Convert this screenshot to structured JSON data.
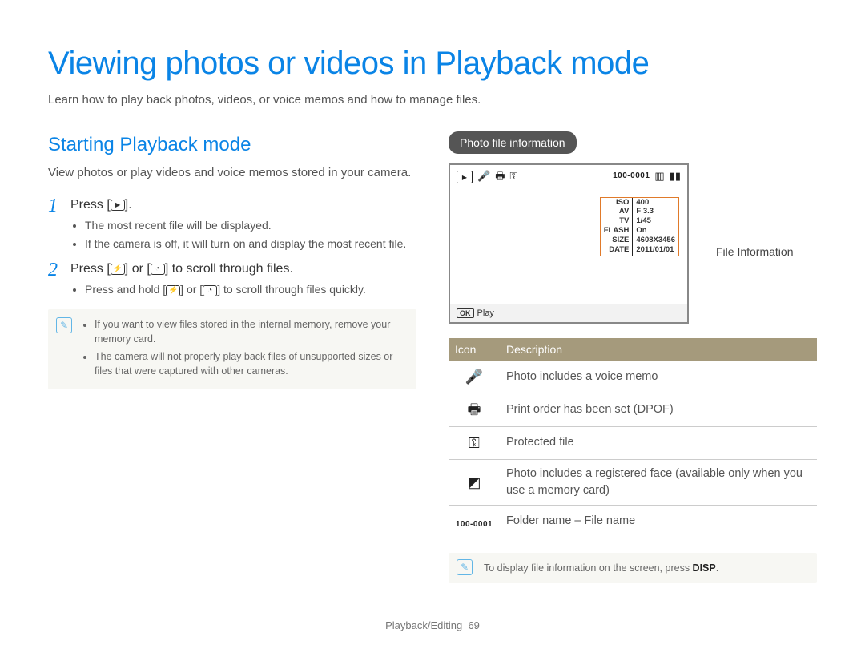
{
  "page_title": "Viewing photos or videos in Playback mode",
  "subtitle": "Learn how to play back photos, videos, or voice memos and how to manage files.",
  "section_title": "Starting Playback mode",
  "section_desc": "View photos or play videos and voice memos stored in your camera.",
  "step1": {
    "num": "1",
    "title_before": "Press [",
    "title_after": "].",
    "bullets": [
      "The most recent file will be displayed.",
      "If the camera is off, it will turn on and display the most recent file."
    ]
  },
  "step2": {
    "num": "2",
    "title_before": "Press [",
    "title_mid": "] or [",
    "title_after": "] to scroll through files.",
    "bullet_before": "Press and hold [",
    "bullet_mid": "] or [",
    "bullet_after": "] to scroll through files quickly."
  },
  "note1": {
    "items": [
      "If you want to view files stored in the internal memory, remove your memory card.",
      "The camera will not properly play back files of unsupported sizes or files that were captured with other cameras."
    ]
  },
  "pill": "Photo file information",
  "shot": {
    "file_code": "100-0001",
    "info_rows": [
      {
        "k": "ISO",
        "v": "400"
      },
      {
        "k": "AV",
        "v": "F 3.3"
      },
      {
        "k": "TV",
        "v": "1/45"
      },
      {
        "k": "FLASH",
        "v": "On"
      },
      {
        "k": "SIZE",
        "v": "4608X3456"
      },
      {
        "k": "DATE",
        "v": "2011/01/01"
      }
    ],
    "bottom_ok": "OK",
    "bottom_label": "Play"
  },
  "lead_label": "File Information",
  "icon_table": {
    "headers": {
      "icon": "Icon",
      "desc": "Description"
    },
    "rows": [
      {
        "glyph": "🎤",
        "name": "voice-memo-icon",
        "desc": "Photo includes a voice memo"
      },
      {
        "glyph": "🖶",
        "name": "print-order-icon",
        "desc": "Print order has been set (DPOF)"
      },
      {
        "glyph": "⚿",
        "name": "protected-file-icon",
        "desc": "Protected file"
      },
      {
        "glyph": "◩",
        "name": "registered-face-icon",
        "desc": "Photo includes a registered face (available only when you use a memory card)"
      },
      {
        "glyph": "100-0001",
        "name": "folder-file-code",
        "desc": "Folder name – File name"
      }
    ]
  },
  "note2": {
    "text_before": "To display file information on the screen, press ",
    "disp": "DISP",
    "text_after": "."
  },
  "footer": {
    "section": "Playback/Editing",
    "page": "69"
  }
}
